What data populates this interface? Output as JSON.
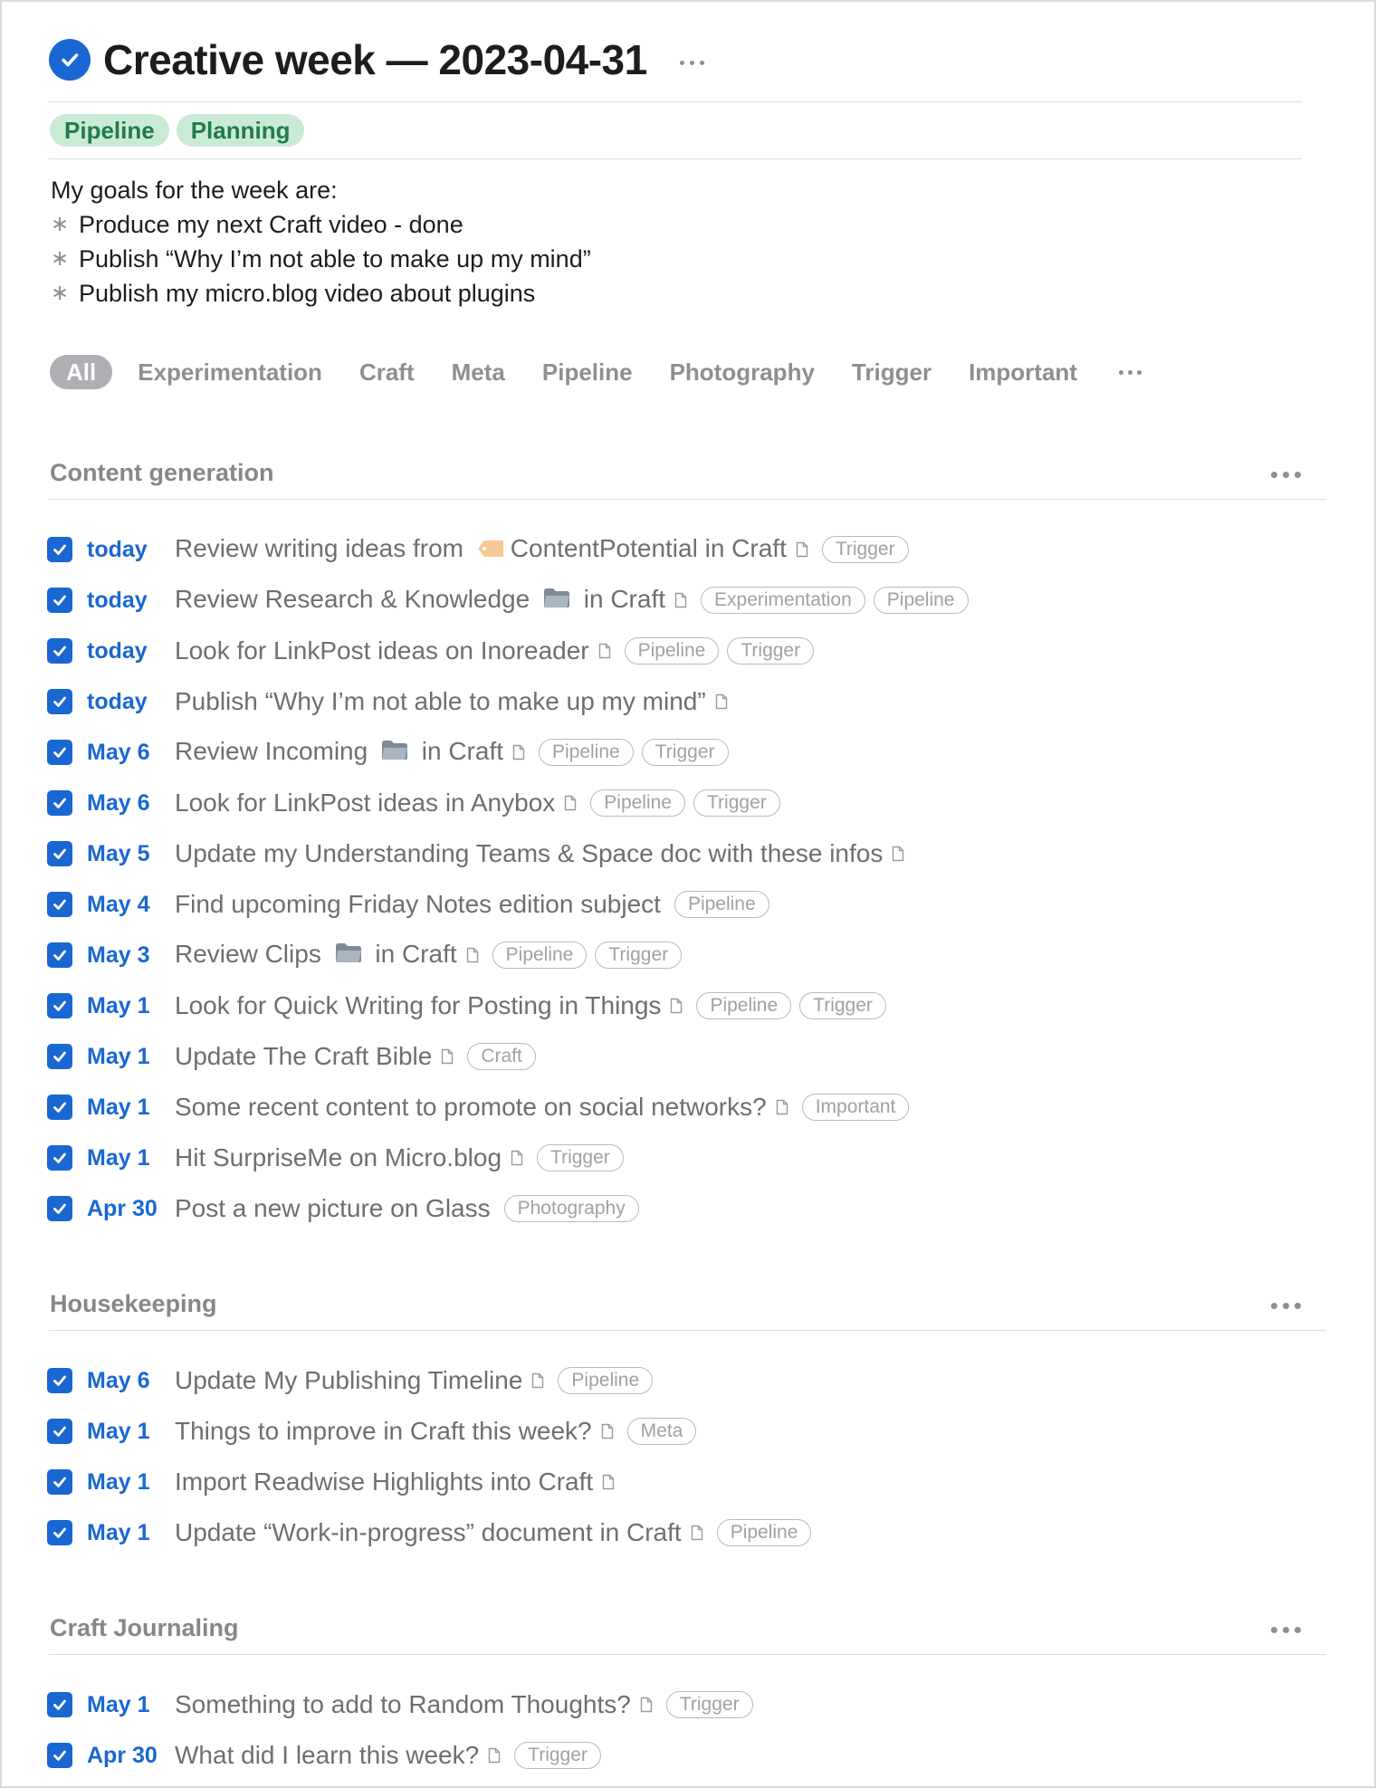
{
  "header": {
    "title": "Creative week — 2023-04-31",
    "tags": [
      "Pipeline",
      "Planning"
    ]
  },
  "description": {
    "intro": "My goals for the week are:",
    "bullet_symbol": "∗",
    "items": [
      "Produce my next Craft video - done",
      "Publish “Why I’m not able to make up my mind”",
      "Publish my micro.blog video about plugins"
    ]
  },
  "filters": {
    "items": [
      "All",
      "Experimentation",
      "Craft",
      "Meta",
      "Pipeline",
      "Photography",
      "Trigger",
      "Important"
    ],
    "active": "All"
  },
  "sections": [
    {
      "title": "Content generation",
      "tasks": [
        {
          "date": "today",
          "parts": [
            {
              "t": "Review writing ideas from "
            },
            {
              "icon": "tag-icon"
            },
            {
              "t": "ContentPotential in Craft"
            }
          ],
          "tags": [
            "Trigger"
          ]
        },
        {
          "date": "today",
          "parts": [
            {
              "t": "Review Research & Knowledge "
            },
            {
              "icon": "folder-icon"
            },
            {
              "t": " in Craft"
            }
          ],
          "tags": [
            "Experimentation",
            "Pipeline"
          ]
        },
        {
          "date": "today",
          "parts": [
            {
              "t": "Look for LinkPost ideas on Inoreader"
            }
          ],
          "tags": [
            "Pipeline",
            "Trigger"
          ]
        },
        {
          "date": "today",
          "parts": [
            {
              "t": "Publish “Why I’m not able to make up my mind”"
            }
          ],
          "tags": []
        },
        {
          "date": "May 6",
          "parts": [
            {
              "t": "Review Incoming "
            },
            {
              "icon": "folder-icon"
            },
            {
              "t": " in Craft"
            }
          ],
          "tags": [
            "Pipeline",
            "Trigger"
          ]
        },
        {
          "date": "May 6",
          "parts": [
            {
              "t": "Look for LinkPost ideas in Anybox"
            }
          ],
          "tags": [
            "Pipeline",
            "Trigger"
          ]
        },
        {
          "date": "May 5",
          "parts": [
            {
              "t": "Update my Understanding Teams & Space doc with these infos"
            }
          ],
          "tags": []
        },
        {
          "date": "May 4",
          "parts": [
            {
              "t": "Find upcoming Friday Notes edition subject"
            }
          ],
          "tags": [
            "Pipeline"
          ],
          "no_doc": true
        },
        {
          "date": "May 3",
          "parts": [
            {
              "t": "Review Clips "
            },
            {
              "icon": "folder-icon"
            },
            {
              "t": " in Craft"
            }
          ],
          "tags": [
            "Pipeline",
            "Trigger"
          ]
        },
        {
          "date": "May 1",
          "parts": [
            {
              "t": "Look for Quick Writing for Posting in Things"
            }
          ],
          "tags": [
            "Pipeline",
            "Trigger"
          ]
        },
        {
          "date": "May 1",
          "parts": [
            {
              "t": "Update The Craft Bible"
            }
          ],
          "tags": [
            "Craft"
          ]
        },
        {
          "date": "May 1",
          "parts": [
            {
              "t": "Some recent content to promote on social networks?"
            }
          ],
          "tags": [
            "Important"
          ]
        },
        {
          "date": "May 1",
          "parts": [
            {
              "t": "Hit SurpriseMe on Micro.blog"
            }
          ],
          "tags": [
            "Trigger"
          ]
        },
        {
          "date": "Apr 30",
          "parts": [
            {
              "t": "Post a new picture on Glass"
            }
          ],
          "tags": [
            "Photography"
          ],
          "no_doc": true
        }
      ]
    },
    {
      "title": "Housekeeping",
      "tasks": [
        {
          "date": "May 6",
          "parts": [
            {
              "t": "Update My Publishing Timeline"
            }
          ],
          "tags": [
            "Pipeline"
          ]
        },
        {
          "date": "May 1",
          "parts": [
            {
              "t": "Things to improve in Craft this week?"
            }
          ],
          "tags": [
            "Meta"
          ]
        },
        {
          "date": "May 1",
          "parts": [
            {
              "t": "Import Readwise Highlights into Craft"
            }
          ],
          "tags": []
        },
        {
          "date": "May 1",
          "parts": [
            {
              "t": "Update “Work-in-progress” document in Craft"
            }
          ],
          "tags": [
            "Pipeline"
          ]
        }
      ]
    },
    {
      "title": "Craft Journaling",
      "tasks": [
        {
          "date": "May 1",
          "parts": [
            {
              "t": "Something to add to Random Thoughts?"
            }
          ],
          "tags": [
            "Trigger"
          ]
        },
        {
          "date": "Apr 30",
          "parts": [
            {
              "t": "What did I learn this week?"
            }
          ],
          "tags": [
            "Trigger"
          ]
        }
      ]
    }
  ],
  "colors": {
    "accent": "#1967d2",
    "tag_bg": "#c9ebd6",
    "tag_text": "#237a4a",
    "muted": "#86868b"
  }
}
